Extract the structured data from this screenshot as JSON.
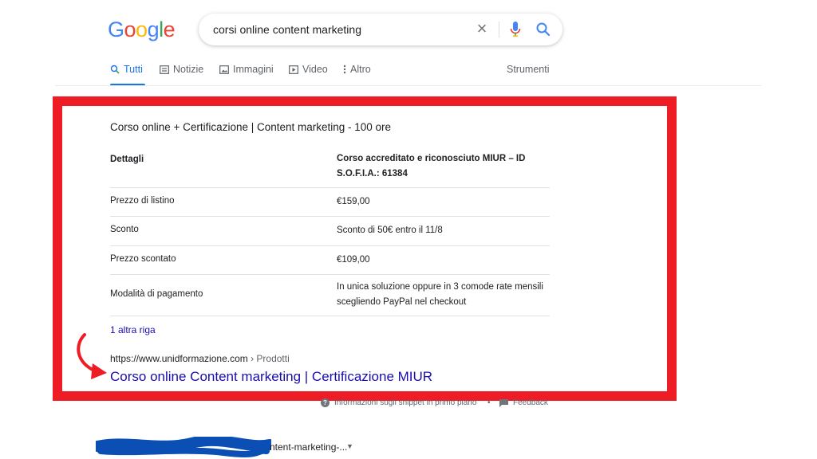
{
  "logo": {
    "text": "Google",
    "colors": [
      "#4285f4",
      "#ea4335",
      "#fbbc05",
      "#4285f4",
      "#34a853",
      "#ea4335"
    ]
  },
  "search": {
    "query": "corsi online content marketing",
    "clear_icon": "close-icon",
    "voice_icon": "mic-icon",
    "search_icon": "search-icon"
  },
  "tabs": [
    {
      "label": "Tutti",
      "icon": "search-icon",
      "active": true
    },
    {
      "label": "Notizie",
      "icon": "newspaper-icon"
    },
    {
      "label": "Immagini",
      "icon": "image-icon"
    },
    {
      "label": "Video",
      "icon": "play-icon"
    },
    {
      "label": "Altro",
      "icon": "more-vert-icon"
    }
  ],
  "tools_label": "Strumenti",
  "snippet": {
    "title": "Corso online + Certificazione | Content marketing - 100 ore",
    "rows": [
      {
        "key": "Dettagli",
        "value": "Corso accreditato e riconosciuto MIUR – ID S.O.F.I.A.: 61384"
      },
      {
        "key": "Prezzo di listino",
        "value": "€159,00"
      },
      {
        "key": "Sconto",
        "value": "Sconto di 50€ entro il 11/8"
      },
      {
        "key": "Prezzo scontato",
        "value": "€109,00"
      },
      {
        "key": "Modalità di pagamento",
        "value": "In unica soluzione oppure in 3 comode rate mensili scegliendo PayPal nel checkout"
      }
    ],
    "more_rows": "1 altra riga",
    "url": "https://www.unidformazione.com",
    "breadcrumb": " › Prodotti",
    "link_title": "Corso online Content marketing | Certificazione MIUR"
  },
  "footer": {
    "info": "Informazioni sugli snippet in primo piano",
    "separator": "•",
    "feedback": "Feedback"
  },
  "next_result": {
    "url_fragment": "ntent-marketing-...",
    "caret": "▼"
  },
  "accent": {
    "frame": "#ee1c25",
    "link": "#1a0dab",
    "active_tab": "#1a73e8",
    "scribble": "#0b4fb4"
  }
}
